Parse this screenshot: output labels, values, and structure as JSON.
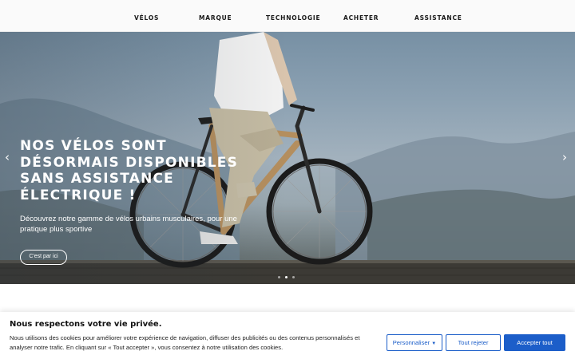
{
  "nav": {
    "items": [
      "VÉLOS",
      "MARQUE",
      "TECHNOLOGIE",
      "ACHETER",
      "ASSISTANCE"
    ]
  },
  "hero": {
    "title": "NOS VÉLOS SONT DÉSORMAIS DISPONIBLES SANS ASSISTANCE ÉLECTRIQUE !",
    "subtitle": "Découvrez notre gamme de vélos urbains musculaires, pour une pratique plus sportive",
    "cta_label": "C'est par ici",
    "prev_icon": "chevron-left-icon",
    "next_icon": "chevron-right-icon",
    "slides_total": 3,
    "slide_active": 2
  },
  "cookie": {
    "title": "Nous respectons votre vie privée.",
    "text": "Nous utilisons des cookies pour améliorer votre expérience de navigation, diffuser des publicités ou des contenus personnalisés et analyser notre trafic. En cliquant sur « Tout accepter », vous consentez à notre utilisation des cookies.",
    "customize_label": "Personnaliser",
    "reject_label": "Tout rejeter",
    "accept_label": "Accepter tout"
  },
  "colors": {
    "accent": "#1c5ec9",
    "nav_bg": "#fafafa"
  }
}
